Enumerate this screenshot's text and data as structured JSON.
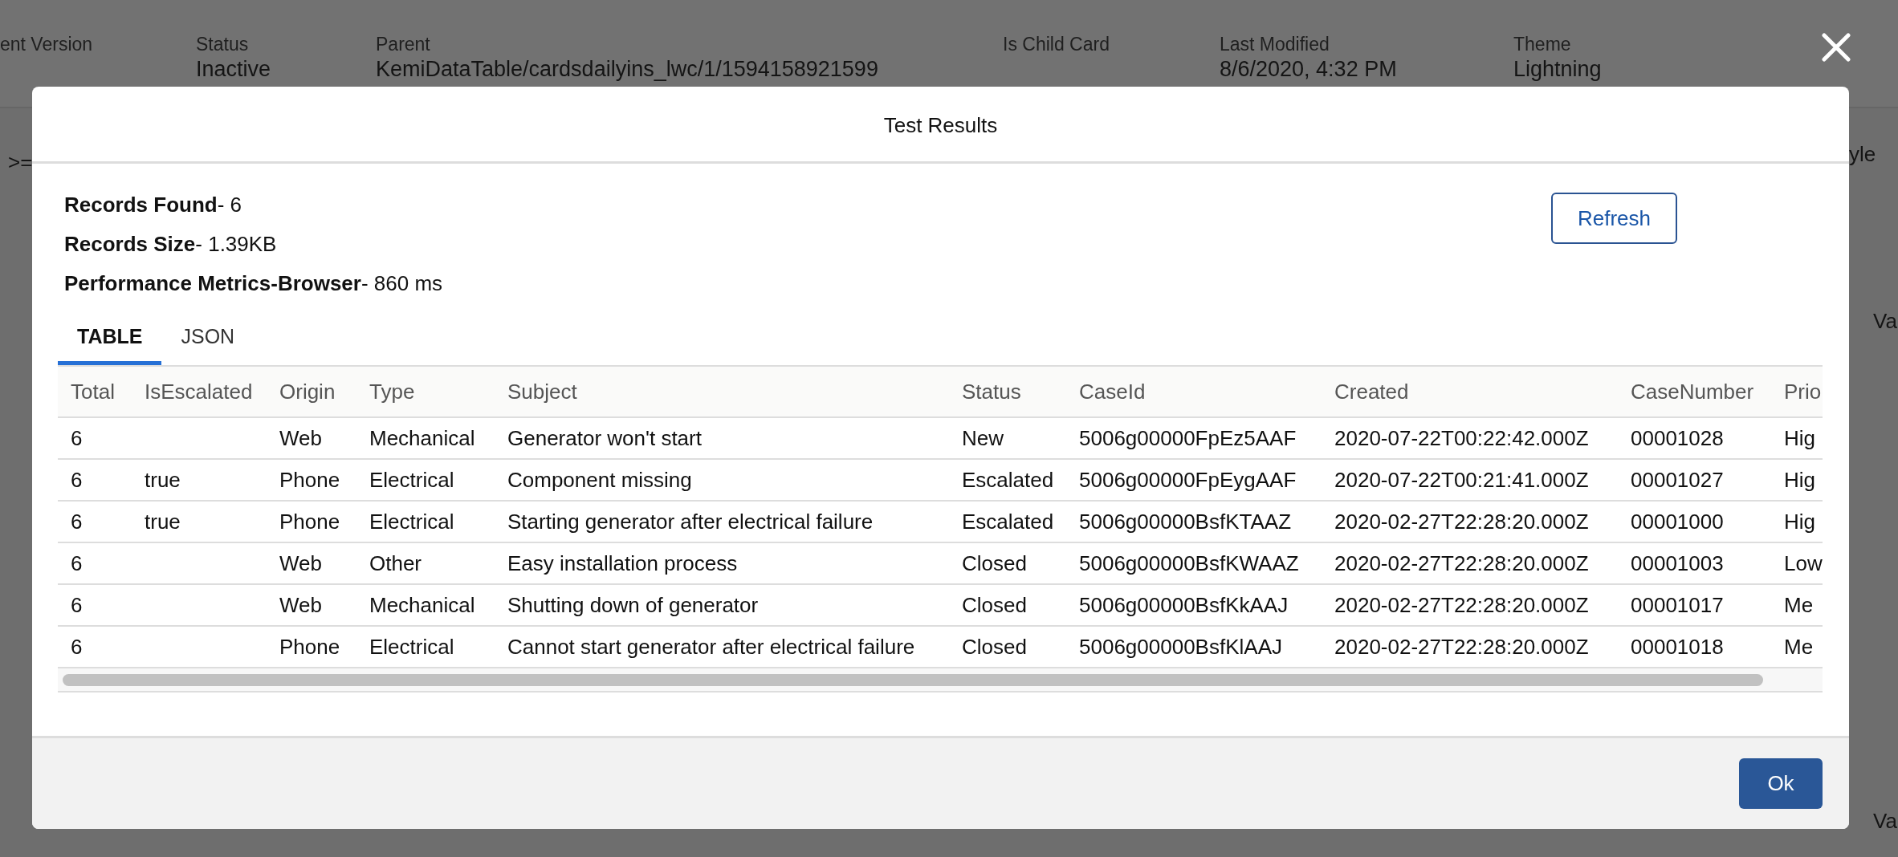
{
  "page_header": {
    "fields": [
      {
        "label": "ent Version"
      },
      {
        "label": "Status",
        "value": "Inactive"
      },
      {
        "label": "Parent",
        "value": "KemiDataTable/cardsdailyins_lwc/1/1594158921599"
      },
      {
        "label": "Is Child Card"
      },
      {
        "label": "Last Modified",
        "value": "8/6/2020, 4:32 PM"
      },
      {
        "label": "Theme",
        "value": "Lightning"
      }
    ]
  },
  "background_fragments": [
    ">=",
    "yle",
    "Va",
    "Va"
  ],
  "modal": {
    "title": "Test Results",
    "stats": [
      "**Records Found**- 6",
      "**Records Size**- 1.39KB",
      "**Performance Metrics-Browser**- 860 ms"
    ],
    "refresh_button": "Refresh",
    "tabs": [
      {
        "label": "TABLE",
        "selected": true
      },
      {
        "label": "JSON",
        "selected": false
      }
    ],
    "table": {
      "columns": [
        "Total",
        "IsEscalated",
        "Origin",
        "Type",
        "Subject",
        "Status",
        "CaseId",
        "Created",
        "CaseNumber",
        "Prio"
      ],
      "rows": [
        [
          "6",
          null,
          "Web",
          "Mechanical",
          "Generator won't start",
          "New",
          "5006g00000FpEz5AAF",
          "2020-07-22T00:22:42.000Z",
          "00001028",
          "Hig"
        ],
        [
          "6",
          "true",
          "Phone",
          "Electrical",
          "Component missing",
          "Escalated",
          "5006g00000FpEygAAF",
          "2020-07-22T00:21:41.000Z",
          "00001027",
          "Hig"
        ],
        [
          "6",
          "true",
          "Phone",
          "Electrical",
          "Starting generator after electrical failure",
          "Escalated",
          "5006g00000BsfKTAAZ",
          "2020-02-27T22:28:20.000Z",
          "00001000",
          "Hig"
        ],
        [
          "6",
          null,
          "Web",
          "Other",
          "Easy installation process",
          "Closed",
          "5006g00000BsfKWAAZ",
          "2020-02-27T22:28:20.000Z",
          "00001003",
          "Low"
        ],
        [
          "6",
          null,
          "Web",
          "Mechanical",
          "Shutting down of generator",
          "Closed",
          "5006g00000BsfKkAAJ",
          "2020-02-27T22:28:20.000Z",
          "00001017",
          "Me"
        ],
        [
          "6",
          null,
          "Phone",
          "Electrical",
          "Cannot start generator after electrical failure",
          "Closed",
          "5006g00000BsfKlAAJ",
          "2020-02-27T22:28:20.000Z",
          "00001018",
          "Me"
        ]
      ]
    },
    "ok_button": "Ok"
  }
}
